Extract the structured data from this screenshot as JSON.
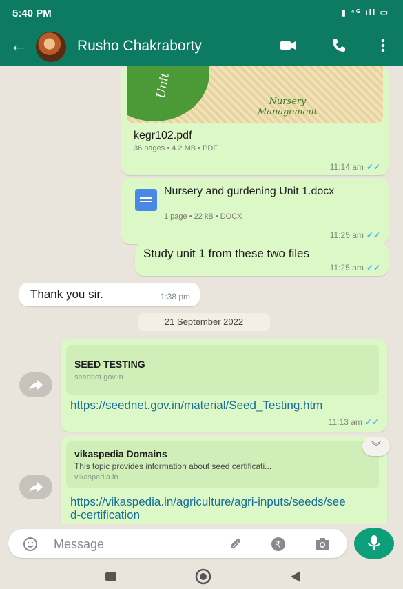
{
  "status": {
    "time": "5:40 PM",
    "icons": "▮ ⁴ᴳ ıll ▭"
  },
  "header": {
    "back_label": "←",
    "contact_name": "Rusho Chakraborty"
  },
  "messages": {
    "pdf": {
      "thumb_unit": "Unit",
      "thumb_title": "Nursery\nManagement",
      "name": "kegr102.pdf",
      "meta": "36 pages • 4.2 MB • PDF",
      "time": "11:14 am"
    },
    "docx": {
      "name": "Nursery and gurdening Unit 1.docx",
      "meta": "1 page • 22 kB • DOCX",
      "time": "11:25 am"
    },
    "study": {
      "text": "Study unit 1 from these two files",
      "time": "11:25 am"
    },
    "thanks": {
      "text": "Thank you sir.",
      "time": "1:38 pm"
    },
    "date_chip": "21 September 2022",
    "link1": {
      "preview_title": "SEED TESTING",
      "preview_site": "seednet.gov.in",
      "url": "https://seednet.gov.in/material/Seed_Testing.htm",
      "time": "11:13 am"
    },
    "link2": {
      "preview_title": "vikaspedia Domains",
      "preview_desc": "This topic provides information about seed certificati...",
      "preview_site": "vikaspedia.in",
      "url": "https://vikaspedia.in/agriculture/agri-inputs/seeds/seed-certification"
    },
    "ticks": "✓✓"
  },
  "composer": {
    "placeholder": "Message"
  },
  "colors": {
    "header": "#0d7a62",
    "outgoing": "#dcf8c6",
    "mic": "#0d9e7a",
    "link": "#1a6e9a"
  }
}
